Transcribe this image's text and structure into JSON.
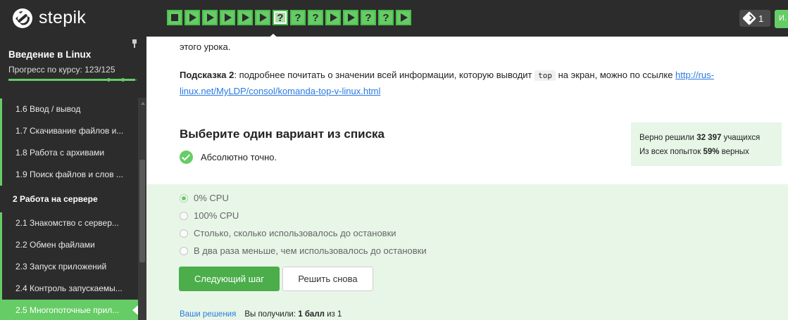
{
  "header": {
    "logo_text": "stepik",
    "steps": [
      "square",
      "play",
      "play",
      "play",
      "play",
      "play",
      "question",
      "question",
      "question",
      "play",
      "play",
      "question",
      "question",
      "play"
    ],
    "current_step_index": 6,
    "notifications_count": "1",
    "avatar_text": "И."
  },
  "sidebar": {
    "course_title": "Введение в Linux",
    "progress_label": "Прогресс по курсу:  123/125",
    "progress_fraction": 0.984,
    "lessons": [
      {
        "label": "1.6 Ввод / вывод",
        "type": "lesson"
      },
      {
        "label": "1.7 Скачивание файлов и...",
        "type": "lesson"
      },
      {
        "label": "1.8 Работа с архивами",
        "type": "lesson"
      },
      {
        "label": "1.9 Поиск файлов и слов ...",
        "type": "lesson"
      },
      {
        "label": "2 Работа на сервере",
        "type": "section"
      },
      {
        "label": "2.1 Знакомство с сервер...",
        "type": "lesson"
      },
      {
        "label": "2.2 Обмен файлами",
        "type": "lesson"
      },
      {
        "label": "2.3 Запуск приложений",
        "type": "lesson"
      },
      {
        "label": "2.4 Контроль запускаемы...",
        "type": "lesson"
      },
      {
        "label": "2.5 Многопоточные прил...",
        "type": "active"
      }
    ]
  },
  "content": {
    "tail_text": "этого урока.",
    "hint_label": "Подсказка 2",
    "hint_text_before": ": подробнее почитать о значении всей информации, которую выводит ",
    "hint_code": "top",
    "hint_text_after": " на экран, можно по ссылке ",
    "hint_link": "http://rus-linux.net/MyLDP/consol/komanda-top-v-linux.html",
    "question_title": "Выберите один вариант из списка",
    "verdict": "Абсолютно точно.",
    "stats": {
      "solved_prefix": "Верно решили ",
      "solved_count": "32 397",
      "solved_suffix": " учащихся",
      "attempts_prefix": "Из всех попыток ",
      "attempts_pct": "59%",
      "attempts_suffix": " верных"
    },
    "options": [
      {
        "label": "0% CPU",
        "selected": true
      },
      {
        "label": "100% CPU",
        "selected": false
      },
      {
        "label": "Столько, сколько использовалось до остановки",
        "selected": false
      },
      {
        "label": "В два раза меньше, чем использовалось до остановки",
        "selected": false
      }
    ],
    "next_button": "Следующий шаг",
    "retry_button": "Решить снова",
    "solutions_link": "Ваши решения",
    "score_prefix": "Вы получили: ",
    "score_value": "1 балл",
    "score_suffix": " из 1"
  }
}
